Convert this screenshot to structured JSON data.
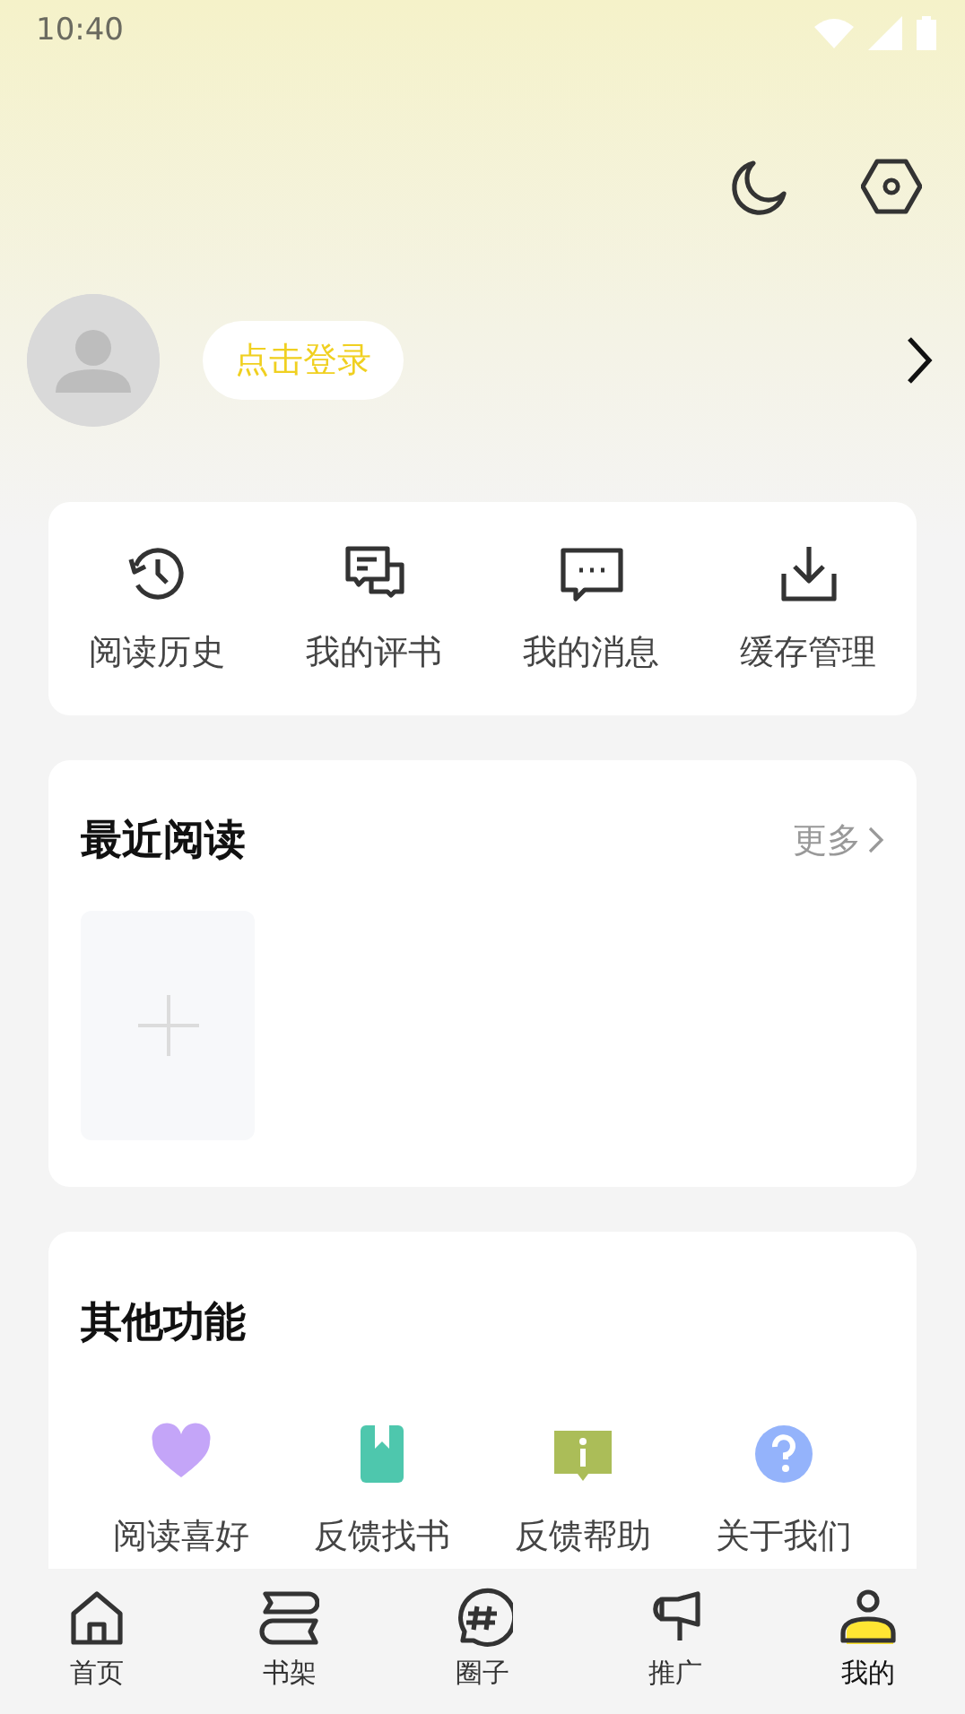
{
  "status_bar": {
    "time": "10:40"
  },
  "profile": {
    "login_label": "点击登录"
  },
  "quick_actions": [
    {
      "kind": "history",
      "label": "阅读历史"
    },
    {
      "kind": "reviews",
      "label": "我的评书"
    },
    {
      "kind": "messages",
      "label": "我的消息"
    },
    {
      "kind": "download",
      "label": "缓存管理"
    }
  ],
  "recent_reading": {
    "title": "最近阅读",
    "more": "更多"
  },
  "other_functions": {
    "title": "其他功能",
    "items": [
      {
        "kind": "heart",
        "label": "阅读喜好",
        "color": "#c4a5f8"
      },
      {
        "kind": "bookmark",
        "label": "反馈找书",
        "color": "#4ec7ad"
      },
      {
        "kind": "info",
        "label": "反馈帮助",
        "color": "#abbd58"
      },
      {
        "kind": "question",
        "label": "关于我们",
        "color": "#94b3fb"
      }
    ]
  },
  "bottom_nav": [
    {
      "kind": "home",
      "label": "首页",
      "selected": false
    },
    {
      "kind": "shelf",
      "label": "书架",
      "selected": false
    },
    {
      "kind": "circle",
      "label": "圈子",
      "selected": false
    },
    {
      "kind": "promote",
      "label": "推广",
      "selected": false
    },
    {
      "kind": "me",
      "label": "我的",
      "selected": true
    }
  ]
}
